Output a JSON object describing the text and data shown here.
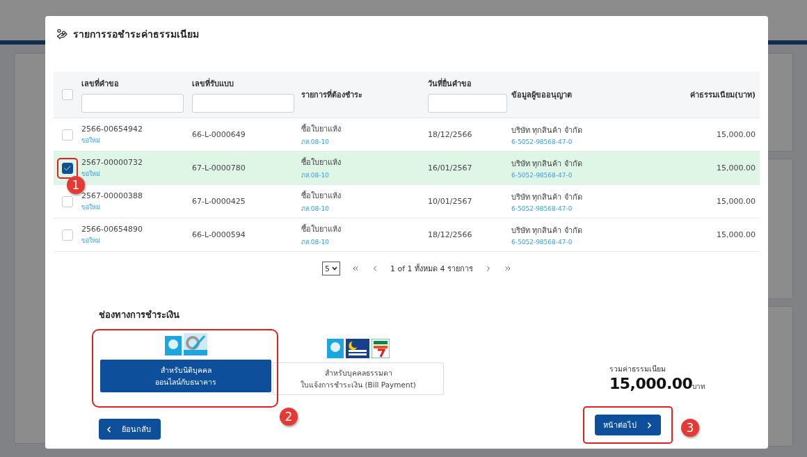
{
  "modal": {
    "title": "รายการรอชำระค่าธรรมเนียม"
  },
  "table": {
    "select_all": {
      "checked": false
    },
    "columns": [
      {
        "label": "เลขที่คำขอ",
        "filter": true
      },
      {
        "label": "เลขที่รับแบบ",
        "filter": true
      },
      {
        "label": "รายการที่ต้องชำระ",
        "filter": false
      },
      {
        "label": "วันที่ยื่นคำขอ",
        "filter": true
      },
      {
        "label": "ข้อมูลผู้ขออนุญาต",
        "filter": false
      },
      {
        "label": "ค่าธรรมเนียม(บาท)",
        "filter": false
      }
    ],
    "rows": [
      {
        "selected": false,
        "request_no": "2566-00654942",
        "request_type": "ขอใหม่",
        "form_no": "66-L-0000649",
        "item": "ซื้อใบยาแห้ง",
        "item_code": "ภส.08-10",
        "date": "18/12/2566",
        "licensee": "บริษัท ทุกสินค้า จำกัด",
        "licensee_id": "6-5052-98568-47-0",
        "fee": "15,000.00"
      },
      {
        "selected": true,
        "request_no": "2567-00000732",
        "request_type": "ขอใหม่",
        "form_no": "67-L-0000780",
        "item": "ซื้อใบยาแห้ง",
        "item_code": "ภส.08-10",
        "date": "16/01/2567",
        "licensee": "บริษัท ทุกสินค้า จำกัด",
        "licensee_id": "6-5052-98568-47-0",
        "fee": "15,000.00"
      },
      {
        "selected": false,
        "request_no": "2567-00000388",
        "request_type": "ขอใหม่",
        "form_no": "67-L-0000425",
        "item": "ซื้อใบยาแห้ง",
        "item_code": "ภส.08-10",
        "date": "10/01/2567",
        "licensee": "บริษัท ทุกสินค้า จำกัด",
        "licensee_id": "6-5052-98568-47-0",
        "fee": "15,000.00"
      },
      {
        "selected": false,
        "request_no": "2566-00654890",
        "request_type": "ขอใหม่",
        "form_no": "66-L-0000594",
        "item": "ซื้อใบยาแห้ง",
        "item_code": "ภส.08-10",
        "date": "18/12/2566",
        "licensee": "บริษัท ทุกสินค้า จำกัด",
        "licensee_id": "6-5052-98568-47-0",
        "fee": "15,000.00"
      }
    ]
  },
  "pagination": {
    "page_size": "5",
    "summary": "1 of 1 ทั้งหมด 4 รายการ"
  },
  "payment": {
    "title": "ช่องทางการชำระเงิน",
    "options": [
      {
        "kind": "corporate",
        "selected": true,
        "line1": "สำหรับนิติบุคคล",
        "line2": "ออนไลน์กับธนาคาร"
      },
      {
        "kind": "individual",
        "selected": false,
        "line1": "สำหรับบุคคลธรรมดา",
        "line2": "ใบแจ้งการชำระเงิน (Bill Payment)"
      }
    ]
  },
  "total": {
    "label": "รวมค่าธรรมเนียม",
    "amount": "15,000.00",
    "unit": "บาท"
  },
  "buttons": {
    "back": "ย้อนกลับ",
    "next": "หน้าต่อไป"
  },
  "annotations": [
    {
      "label": "1"
    },
    {
      "label": "2"
    },
    {
      "label": "3"
    }
  ]
}
